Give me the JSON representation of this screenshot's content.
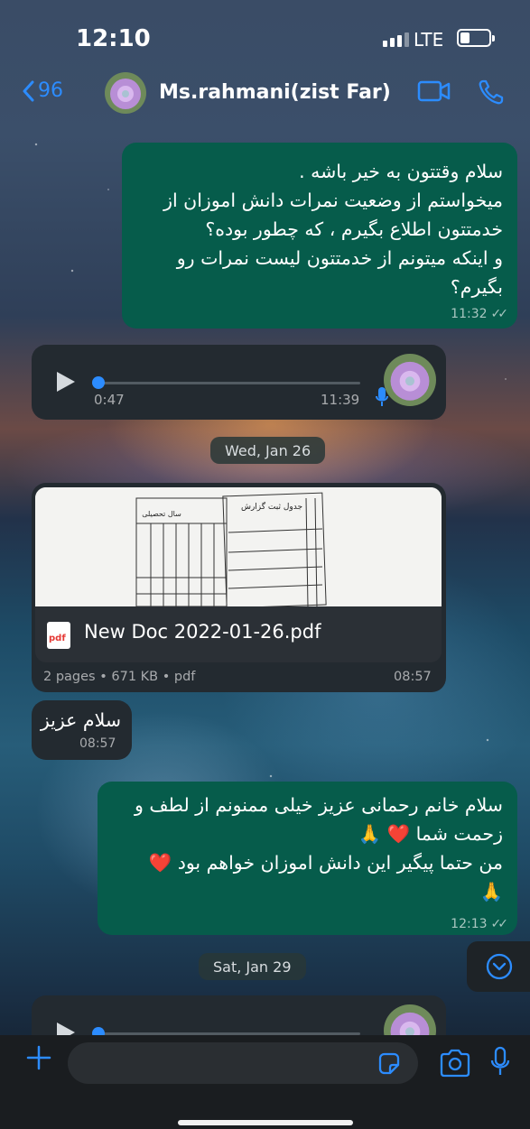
{
  "status_bar": {
    "time": "12:10",
    "network": "LTE"
  },
  "header": {
    "back_count": "96",
    "contact_name": "Ms.rahmani(zist Far)"
  },
  "messages": [
    {
      "direction": "outgoing",
      "type": "text",
      "lines": [
        "سلام وقتتون به خیر باشه .",
        "میخواستم از وضعیت نمرات دانش اموزان از",
        "خدمتتون اطلاع بگیرم ، که چطور بوده؟",
        "و اینکه میتونم از خدمتتون لیست نمرات رو",
        "بگیرم؟"
      ],
      "time": "11:32",
      "read_ticks": "✓✓"
    },
    {
      "direction": "incoming",
      "type": "voice",
      "duration": "0:47",
      "time": "11:39"
    },
    {
      "type": "date",
      "label": "Wed, Jan 26"
    },
    {
      "direction": "incoming",
      "type": "document",
      "preview_title": "جدول ثبت گزارش",
      "preview_year": "سال تحصیلی",
      "file_name": "New Doc 2022-01-26.pdf",
      "file_icon_label": "pdf",
      "file_info": "2 pages • 671 KB • pdf",
      "time": "08:57"
    },
    {
      "direction": "incoming",
      "type": "text",
      "lines": [
        "سلام عزیز"
      ],
      "time": "08:57"
    },
    {
      "direction": "outgoing",
      "type": "text",
      "lines": [
        "سلام خانم رحمانی عزیز خیلی ممنونم از لطف و",
        "زحمت شما ❤️ 🙏",
        "من حتما پیگیر این دانش اموزان خواهم بود ❤️",
        "🙏"
      ],
      "time": "12:13",
      "read_ticks": "✓✓"
    },
    {
      "type": "date",
      "label": "Sat, Jan 29"
    }
  ],
  "input": {
    "placeholder": ""
  },
  "icons": {
    "back": "chevron-left-icon",
    "video_call": "video-camera-icon",
    "voice_call": "phone-icon",
    "attach": "plus-icon",
    "sticker": "sticker-icon",
    "camera": "camera-icon",
    "mic": "microphone-icon",
    "scroll_down": "chevron-down-circle-icon"
  },
  "colors": {
    "accent": "#2c8cff",
    "outgoing_bubble": "#065c4b",
    "incoming_bubble": "#232a30"
  }
}
